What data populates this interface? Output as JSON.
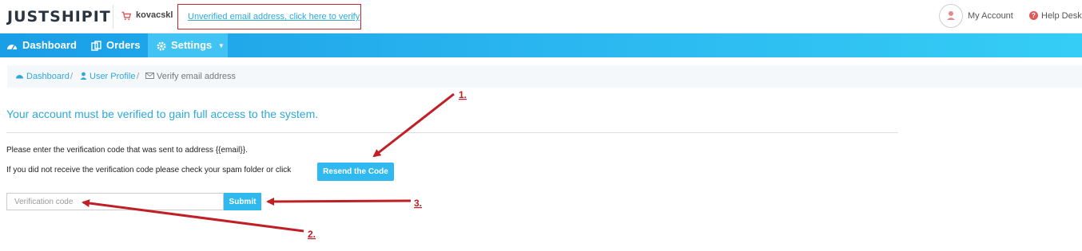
{
  "header": {
    "logo": "JUSTSHIPIT",
    "username": "kovacskl",
    "verify_link": "Unverified email address, click here to verify",
    "my_account": "My Account",
    "help_desk": "Help Desk"
  },
  "nav": {
    "items": [
      {
        "label": "Dashboard",
        "icon": "dashboard-icon"
      },
      {
        "label": "Orders",
        "icon": "orders-icon"
      },
      {
        "label": "Settings",
        "icon": "gear-icon",
        "active": true
      }
    ]
  },
  "breadcrumb": {
    "items": [
      {
        "label": "Dashboard",
        "icon": "dashboard-icon"
      },
      {
        "label": "User Profile",
        "icon": "user-icon"
      },
      {
        "label": "Verify email address",
        "icon": "envelope-icon"
      }
    ],
    "separator": "/"
  },
  "main": {
    "headline": "Your account must be verified to gain full access to the system.",
    "instruction": "Please enter the verification code that was sent to address {{email}}.",
    "spam_note": "If you did not receive the verification code please check your spam folder or click",
    "resend_label": "Resend the Code",
    "code_placeholder": "Verification code",
    "code_value": "",
    "submit_label": "Submit"
  },
  "annotations": {
    "color": "#c01f26",
    "labels": [
      "1.",
      "2.",
      "3."
    ]
  }
}
